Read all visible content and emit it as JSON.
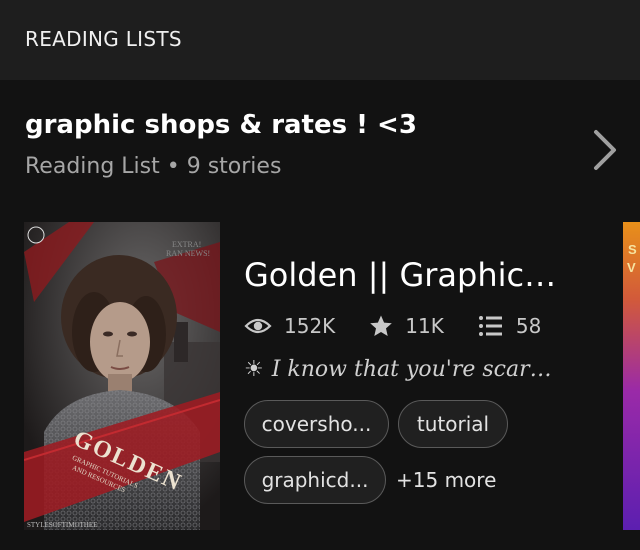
{
  "header": {
    "title": "READING LISTS"
  },
  "reading_list": {
    "title": "graphic shops & rates ! <3",
    "meta": "Reading List • 9 stories",
    "chevron_icon": "chevron-right-icon"
  },
  "story": {
    "title": "Golden || Graphic…",
    "cover": {
      "title": "GOLDEN",
      "subtitle_line1": "GRAPHIC TUTORIALS",
      "subtitle_line2": "AND RESOURCES",
      "small_top": "EXTRA!",
      "small_top2": "RAN NEWS!",
      "credit": "STYLESOFTIMOTHEE"
    },
    "stats": {
      "reads": "152K",
      "votes": "11K",
      "parts": "58",
      "reads_icon": "eye-icon",
      "votes_icon": "star-icon",
      "parts_icon": "list-icon"
    },
    "tagline": {
      "icon": "☀",
      "text": "I know that you're scar…"
    },
    "tags": [
      "coversho...",
      "tutorial",
      "graphicd..."
    ],
    "more_tags": "+15 more"
  },
  "peek_cover": {
    "letters": [
      "S",
      "V"
    ]
  }
}
